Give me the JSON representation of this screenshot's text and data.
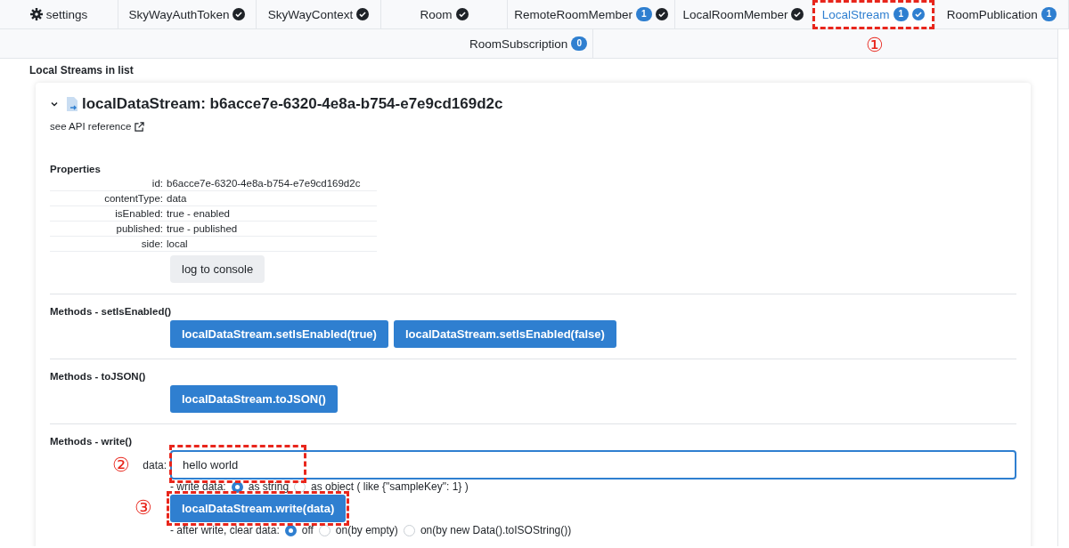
{
  "tabs": [
    {
      "label": "settings",
      "kind": "settings",
      "check": false,
      "selected": false
    },
    {
      "label": "SkyWayAuthToken",
      "check": true,
      "selected": false
    },
    {
      "label": "SkyWayContext",
      "check": true,
      "selected": false
    },
    {
      "label": "Room",
      "check": true,
      "selected": false
    },
    {
      "label": "RemoteRoomMember",
      "badge": "1",
      "check": true,
      "selected": false
    },
    {
      "label": "LocalRoomMember",
      "check": true,
      "selected": false
    },
    {
      "label": "LocalStream",
      "badge": "1",
      "check": true,
      "selected": true,
      "annotation": "①"
    },
    {
      "label": "RoomPublication",
      "badge": "1",
      "check": false,
      "selected": false
    }
  ],
  "tabs_row_2": [
    {
      "label": "RoomSubscription",
      "badge": "0",
      "check": false,
      "selected": false
    }
  ],
  "section_title": "Local Streams in list",
  "stream": {
    "title": "localDataStream: b6acce7e-6320-4e8a-b754-e7e9cd169d2c",
    "expanded": true,
    "api_link": "see API reference",
    "properties_title": "Properties",
    "properties": [
      {
        "key": "id:",
        "value": "b6acce7e-6320-4e8a-b754-e7e9cd169d2c"
      },
      {
        "key": "contentType:",
        "value": "data"
      },
      {
        "key": "isEnabled:",
        "value": "true - enabled"
      },
      {
        "key": "published:",
        "value": "true - published"
      },
      {
        "key": "side:",
        "value": "local"
      }
    ],
    "log_button": "log to console",
    "methods": [
      {
        "title": "Methods - setIsEnabled()",
        "buttons": [
          "localDataStream.setIsEnabled(true)",
          "localDataStream.setIsEnabled(false)"
        ]
      },
      {
        "title": "Methods - toJSON()",
        "buttons": [
          "localDataStream.toJSON()"
        ]
      }
    ],
    "write": {
      "title": "Methods - write()",
      "field_label": "data:",
      "value": "hello world",
      "field_annotation": "②",
      "write_mode_label": "- write data:",
      "write_modes": [
        {
          "label": "as string",
          "selected": true
        },
        {
          "label": "as object ( like {\"sampleKey\": 1} )",
          "selected": false
        }
      ],
      "button": "localDataStream.write(data)",
      "button_annotation": "③",
      "clear_label": "- after write, clear data:",
      "clear_modes": [
        {
          "label": "off",
          "selected": true
        },
        {
          "label": "on(by empty)",
          "selected": false
        },
        {
          "label": "on(by new Data().toISOString())",
          "selected": false
        }
      ]
    }
  }
}
